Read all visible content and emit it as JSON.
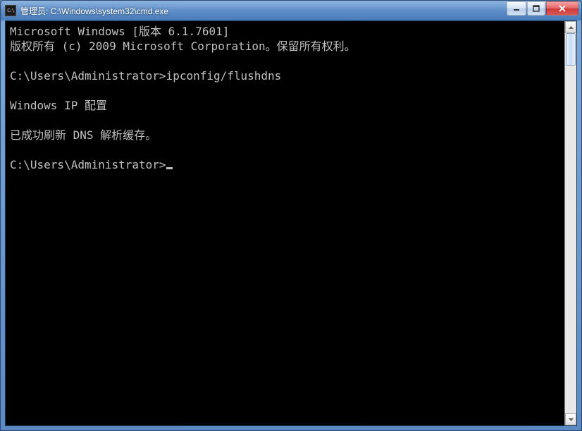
{
  "title": "管理员: C:\\Windows\\system32\\cmd.exe",
  "iconLabel": "C:\\",
  "terminal": {
    "lines": [
      "Microsoft Windows [版本 6.1.7601]",
      "版权所有 (c) 2009 Microsoft Corporation。保留所有权利。",
      "",
      "C:\\Users\\Administrator>ipconfig/flushdns",
      "",
      "Windows IP 配置",
      "",
      "已成功刷新 DNS 解析缓存。",
      "",
      "C:\\Users\\Administrator>"
    ]
  },
  "controls": {
    "minimize": "minimize",
    "maximize": "maximize",
    "close": "close"
  }
}
